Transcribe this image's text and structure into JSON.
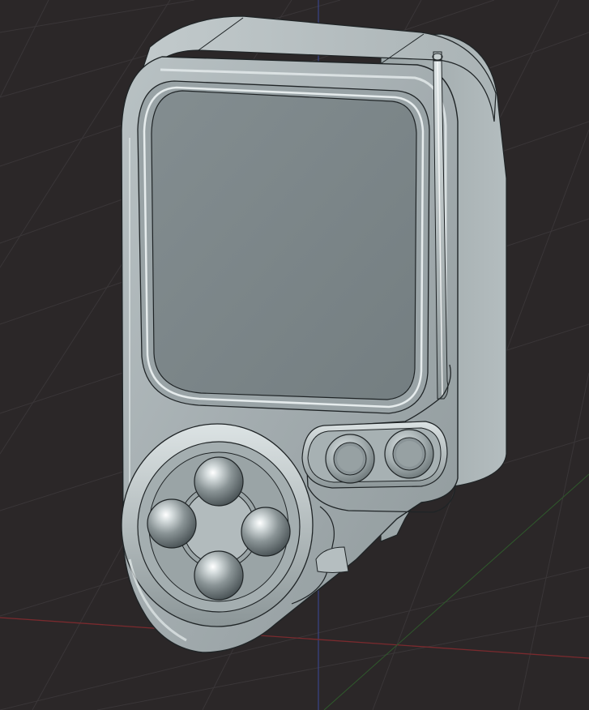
{
  "viewport": {
    "background": "#2b2728",
    "grid_color": "#3a3638",
    "axis_x_color": "#7a2a2e",
    "axis_y_color": "#2f5a2c",
    "axis_z_color": "#3b4a9a"
  },
  "device": {
    "body_color": "#a6b0b3",
    "side_color": "#8d9799",
    "screen_color": "#7a8487",
    "edge_color": "#1f2426",
    "highlight_color": "#e6eced"
  },
  "icons": [
    "dpad-up-icon",
    "dpad-down-icon",
    "dpad-left-icon",
    "dpad-right-icon"
  ]
}
